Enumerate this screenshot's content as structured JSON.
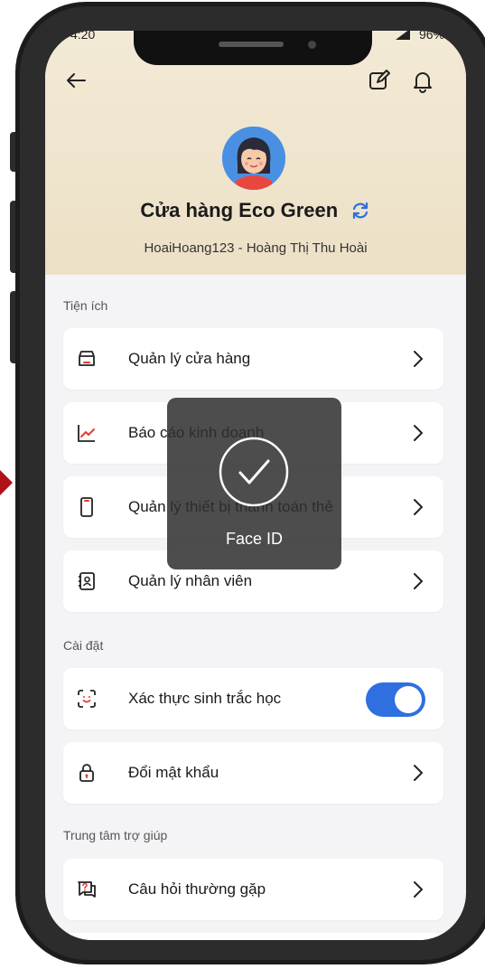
{
  "status_bar": {
    "time": "4:20",
    "battery": "96%"
  },
  "header": {
    "store_name": "Cửa hàng Eco Green",
    "user_line": "HoaiHoang123 - Hoàng Thị Thu Hoài"
  },
  "icons": {
    "back": "arrow-left-icon",
    "edit": "edit-icon",
    "bell": "bell-icon",
    "refresh": "refresh-icon",
    "chevron": "chevron-right-icon"
  },
  "colors": {
    "accent": "#2f6fe0",
    "header_bg": "#efe4cc",
    "page_bg": "#f4f4f6"
  },
  "sections": {
    "utilities": {
      "label": "Tiện ích",
      "items": [
        {
          "label": "Quản lý cửa hàng",
          "icon": "store-icon"
        },
        {
          "label": "Báo cáo kinh doanh",
          "icon": "chart-icon"
        },
        {
          "label": "Quản lý thiết bị thanh toán thẻ",
          "icon": "phone-device-icon"
        },
        {
          "label": "Quản lý nhân viên",
          "icon": "staff-icon"
        }
      ]
    },
    "settings": {
      "label": "Cài đặt",
      "items": [
        {
          "label": "Xác thực sinh trắc học",
          "icon": "face-scan-icon",
          "toggle_on": true
        },
        {
          "label": "Đổi mật khẩu",
          "icon": "lock-icon"
        }
      ]
    },
    "help": {
      "label": "Trung tâm trợ giúp",
      "items": [
        {
          "label": "Câu hỏi thường gặp",
          "icon": "faq-icon"
        }
      ]
    }
  },
  "overlay": {
    "label": "Face ID",
    "icon": "checkmark-circle-icon"
  }
}
